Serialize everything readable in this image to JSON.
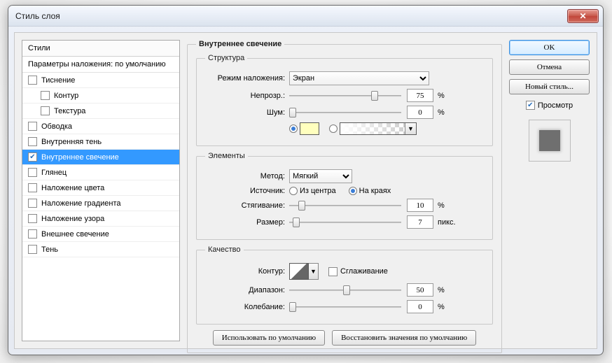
{
  "window": {
    "title": "Стиль слоя"
  },
  "sidebar": {
    "header": "Стили",
    "subheader": "Параметры наложения: по умолчанию",
    "items": [
      {
        "label": "Тиснение",
        "checked": false,
        "indent": false
      },
      {
        "label": "Контур",
        "checked": false,
        "indent": true
      },
      {
        "label": "Текстура",
        "checked": false,
        "indent": true
      },
      {
        "label": "Обводка",
        "checked": false,
        "indent": false
      },
      {
        "label": "Внутренняя тень",
        "checked": false,
        "indent": false
      },
      {
        "label": "Внутреннее свечение",
        "checked": true,
        "indent": false,
        "selected": true
      },
      {
        "label": "Глянец",
        "checked": false,
        "indent": false
      },
      {
        "label": "Наложение цвета",
        "checked": false,
        "indent": false
      },
      {
        "label": "Наложение градиента",
        "checked": false,
        "indent": false
      },
      {
        "label": "Наложение узора",
        "checked": false,
        "indent": false
      },
      {
        "label": "Внешнее свечение",
        "checked": false,
        "indent": false
      },
      {
        "label": "Тень",
        "checked": false,
        "indent": false
      }
    ]
  },
  "panel": {
    "title": "Внутреннее свечение",
    "structure": {
      "legend": "Структура",
      "blend_label": "Режим наложения:",
      "blend_value": "Экран",
      "opacity_label": "Непрозр.:",
      "opacity_value": "75",
      "opacity_unit": "%",
      "noise_label": "Шум:",
      "noise_value": "0",
      "noise_unit": "%",
      "color_type": "solid",
      "solid_color": "#ffffbe"
    },
    "elements": {
      "legend": "Элементы",
      "method_label": "Метод:",
      "method_value": "Мягкий",
      "source_label": "Источник:",
      "source_center": "Из центра",
      "source_edge": "На краях",
      "source_value": "edge",
      "choke_label": "Стягивание:",
      "choke_value": "10",
      "choke_unit": "%",
      "size_label": "Размер:",
      "size_value": "7",
      "size_unit": "пикс."
    },
    "quality": {
      "legend": "Качество",
      "contour_label": "Контур:",
      "antialias_label": "Сглаживание",
      "antialias_checked": false,
      "range_label": "Диапазон:",
      "range_value": "50",
      "range_unit": "%",
      "jitter_label": "Колебание:",
      "jitter_value": "0",
      "jitter_unit": "%"
    },
    "buttons": {
      "make_default": "Использовать по умолчанию",
      "reset_default": "Восстановить значения по умолчанию"
    }
  },
  "actions": {
    "ok": "OK",
    "cancel": "Отмена",
    "new_style": "Новый стиль...",
    "preview_label": "Просмотр",
    "preview_checked": true
  }
}
